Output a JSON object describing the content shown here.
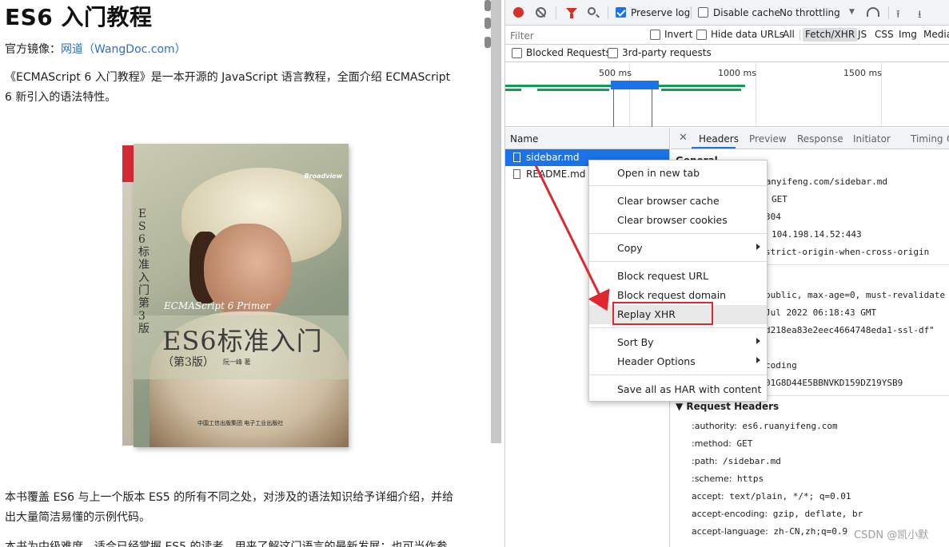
{
  "page": {
    "title": "ES6 入门教程",
    "mirror_label": "官方镜像：",
    "mirror_link": "网道（WangDoc.com）",
    "intro_line1": "《ECMAScript 6 入门教程》是一本开源的 JavaScript 语言教程，全面介绍 ECMAScript",
    "intro_line2": "6 新引入的语法特性。",
    "para2_line1": "本书覆盖 ES6 与上一个版本 ES5 的所有不同之处，对涉及的语法知识给予详细介绍，并给",
    "para2_line2": "出大量简洁易懂的示例代码。",
    "para3_line1": "本书为中级难度，适合已经掌握 ES5 的读者，用来了解这门语言的最新发展；也可当作参",
    "book": {
      "series": "Broadview",
      "vertical_title": "ES6标准入门",
      "vertical_edition": "第3版",
      "english_title": "ECMAScript 6 Primer",
      "title": "ES6标准入门",
      "edition": "（第3版）",
      "author": "阮一峰 著",
      "publisher": "中国工信出版集团  电子工业出版社"
    }
  },
  "devtools": {
    "toolbar": {
      "preserve_log": "Preserve log",
      "preserve_log_checked": true,
      "disable_cache": "Disable cache",
      "disable_cache_checked": false,
      "throttling": "No throttling"
    },
    "filter": {
      "placeholder": "Filter",
      "invert": "Invert",
      "hide_data_urls": "Hide data URLs",
      "types": [
        "All",
        "Fetch/XHR",
        "JS",
        "CSS",
        "Img",
        "Media"
      ],
      "selected_type": "Fetch/XHR",
      "blocked_requests": "Blocked Requests",
      "third_party": "3rd-party requests"
    },
    "overview": {
      "ticks": [
        "500 ms",
        "1000 ms",
        "1500 ms"
      ]
    },
    "requests": {
      "header": "Name",
      "rows": [
        {
          "name": "sidebar.md",
          "selected": true
        },
        {
          "name": "README.md",
          "selected": false
        }
      ]
    },
    "detail": {
      "tabs": [
        "Headers",
        "Preview",
        "Response",
        "Initiator",
        "Timing",
        "C"
      ],
      "active_tab": "Headers",
      "general_header": "General",
      "general": {
        "url": "https://es6.ruanyifeng.com/sidebar.md",
        "method": "GET",
        "status": "304",
        "remote": "104.198.14.52:443",
        "referrer": "strict-origin-when-cross-origin"
      },
      "response_frag": {
        "cache": "public, max-age=0, must-revalidate",
        "date": "Jul 2022 06:18:43 GMT",
        "etag": "d218ea83e2eec4664748eda1-ssl-df\"",
        "vary": "coding",
        "id": "01G8D44E5BBNVKD159DZ19YSB9"
      },
      "request_headers_title": "Request Headers",
      "request_headers": [
        {
          "k": ":authority:",
          "v": "es6.ruanyifeng.com"
        },
        {
          "k": ":method:",
          "v": "GET"
        },
        {
          "k": ":path:",
          "v": "/sidebar.md"
        },
        {
          "k": ":scheme:",
          "v": "https"
        },
        {
          "k": "accept:",
          "v": "text/plain, */*; q=0.01"
        },
        {
          "k": "accept-encoding:",
          "v": "gzip, deflate, br"
        },
        {
          "k": "accept-language:",
          "v": "zh-CN,zh;q=0.9"
        }
      ]
    },
    "context_menu": {
      "open_new_tab": "Open in new tab",
      "clear_cache": "Clear browser cache",
      "clear_cookies": "Clear browser cookies",
      "copy": "Copy",
      "block_url": "Block request URL",
      "block_domain": "Block request domain",
      "replay_xhr": "Replay XHR",
      "sort_by": "Sort By",
      "header_options": "Header Options",
      "save_har": "Save all as HAR with content"
    }
  },
  "watermark": "CSDN @凯小默",
  "colors": {
    "accent": "#1a73e8",
    "record": "#d93025",
    "annotation": "#e0262f",
    "timeline": "#0f9d58"
  }
}
